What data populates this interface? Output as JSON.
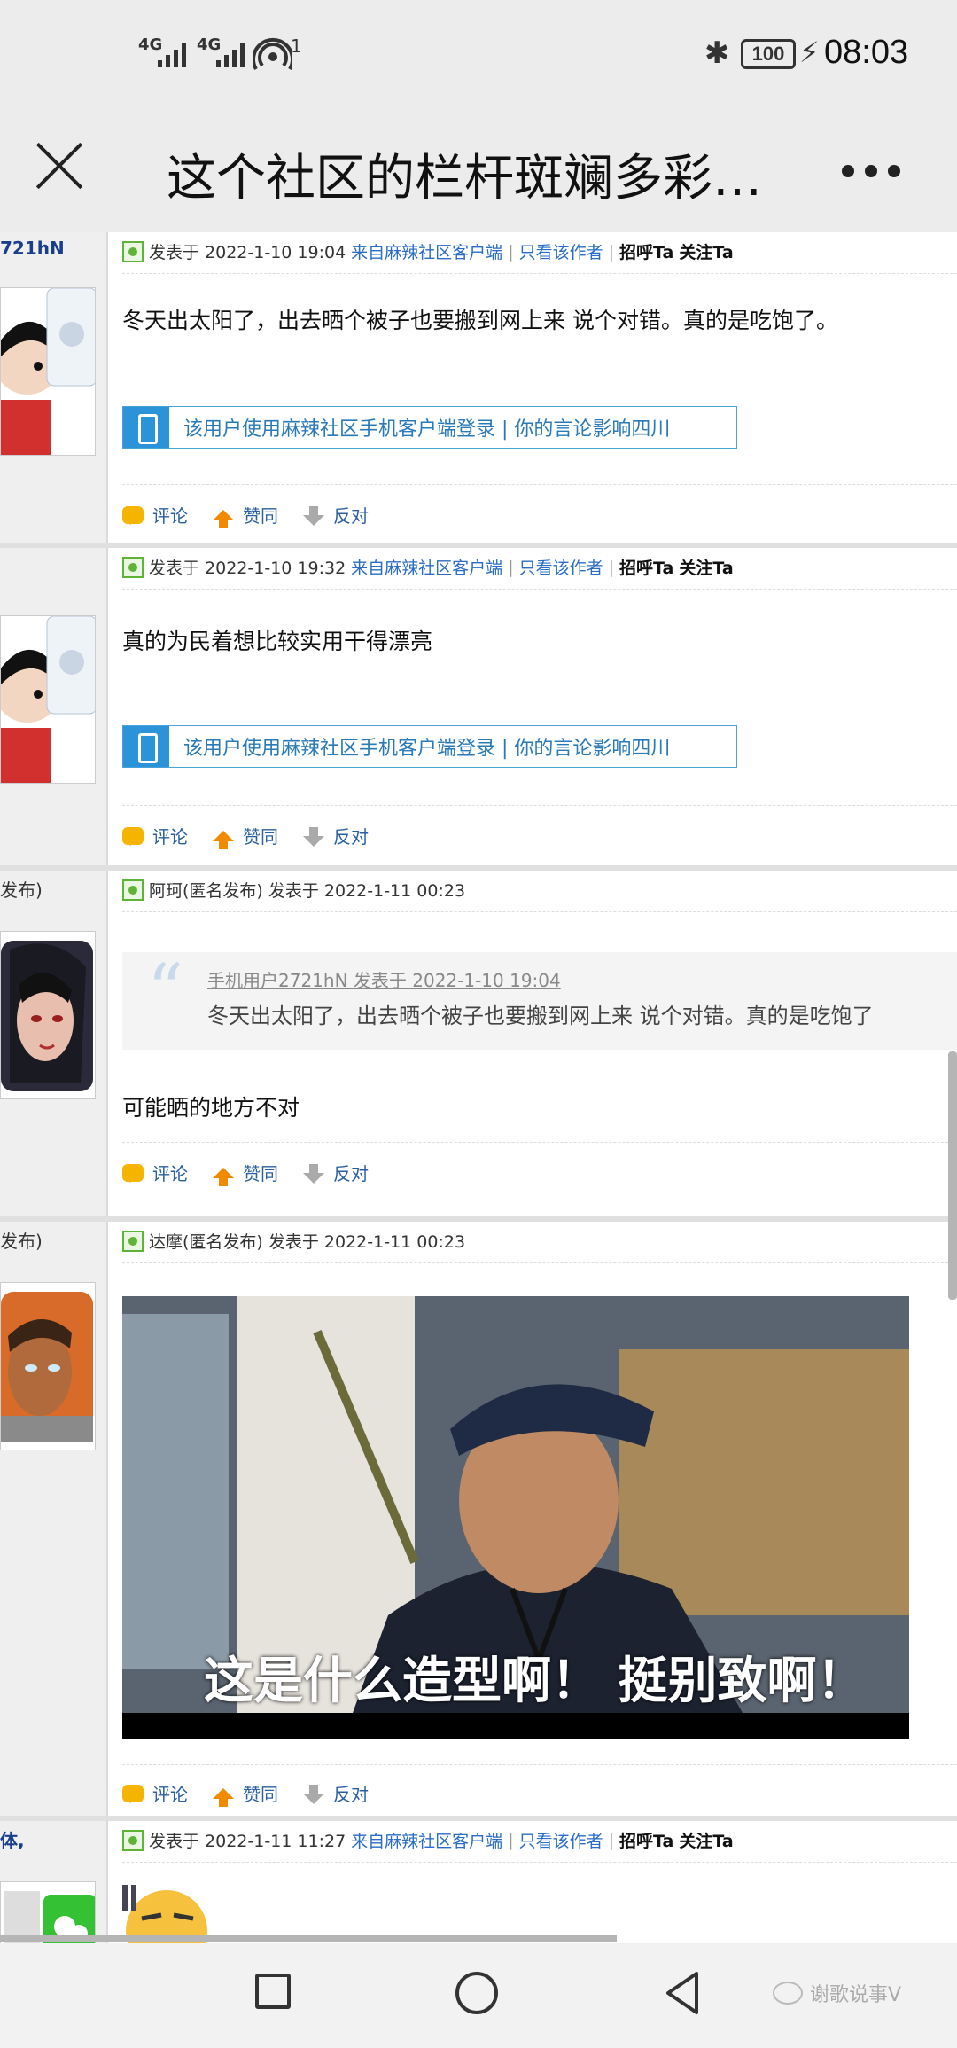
{
  "status_bar": {
    "signal1": "4G",
    "signal2": "4G",
    "hotspot_count": "1",
    "battery": "100",
    "time": "08:03"
  },
  "title_bar": {
    "title": "这个社区的栏杆斑斓多彩…"
  },
  "posts": [
    {
      "user": "721hN",
      "meta": {
        "posted": "发表于 2022-1-10 19:04",
        "source": "来自麻辣社区客户端",
        "sep": "|",
        "only_author": "只看该作者",
        "sep2": "|",
        "greet": "招呼Ta",
        "follow": "关注Ta"
      },
      "text": "冬天出太阳了，出去晒个被子也要搬到网上来 说个对错。真的是吃饱了。",
      "banner": "该用户使用麻辣社区手机客户端登录 | 你的言论影响四川",
      "actions": {
        "comment": "评论",
        "agree": "赞同",
        "oppose": "反对"
      }
    },
    {
      "meta": {
        "posted": "发表于 2022-1-10 19:32",
        "source": "来自麻辣社区客户端",
        "sep": "|",
        "only_author": "只看该作者",
        "sep2": "|",
        "greet": "招呼Ta",
        "follow": "关注Ta"
      },
      "text": "真的为民着想比较实用干得漂亮",
      "banner": "该用户使用麻辣社区手机客户端登录 | 你的言论影响四川",
      "actions": {
        "comment": "评论",
        "agree": "赞同",
        "oppose": "反对"
      }
    },
    {
      "user": "发布)",
      "meta": {
        "posted": "阿珂(匿名发布) 发表于 2022-1-11 00:23"
      },
      "quote": {
        "mark": "“",
        "head": "手机用户2721hN 发表于 2022-1-10 19:04",
        "text": "冬天出太阳了，出去晒个被子也要搬到网上来 说个对错。真的是吃饱了"
      },
      "text": "可能晒的地方不对",
      "actions": {
        "comment": "评论",
        "agree": "赞同",
        "oppose": "反对"
      }
    },
    {
      "user": "发布)",
      "meta": {
        "posted": "达摩(匿名发布) 发表于 2022-1-11 00:23"
      },
      "image_caption": "这是什么造型啊！ 挺别致啊！",
      "actions": {
        "comment": "评论",
        "agree": "赞同",
        "oppose": "反对"
      }
    },
    {
      "user": "体,",
      "meta": {
        "posted": "发表于 2022-1-11 11:27",
        "source": "来自麻辣社区客户端",
        "sep": "|",
        "only_author": "只看该作者",
        "sep2": "|",
        "greet": "招呼Ta",
        "follow": "关注Ta"
      }
    }
  ],
  "watermark": "谢歌说事V",
  "colors": {
    "link": "#2a6cc6",
    "username": "#1a3e8c",
    "banner_border": "#49a4d8",
    "agree_icon": "#f08a00",
    "comment_icon": "#f4b400"
  }
}
